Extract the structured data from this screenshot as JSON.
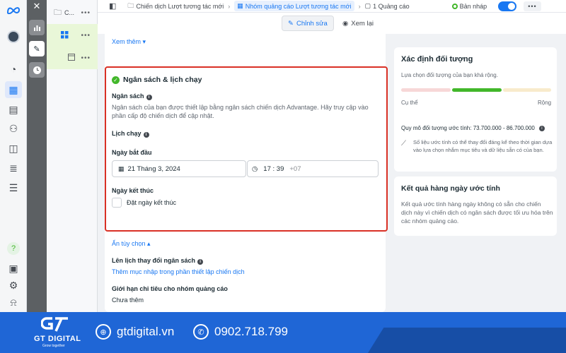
{
  "topbar": {
    "campaign": "Chiến dịch Lượt tương tác mới",
    "adset": "Nhóm quảng cáo Lượt tương tác mới",
    "ad": "1 Quảng cáo",
    "status": "Bản nháp"
  },
  "tree": {
    "campaign_label": "C..."
  },
  "mode": {
    "edit": "Chỉnh sửa",
    "review": "Xem lại"
  },
  "main": {
    "see_more": "Xem thêm",
    "section_title": "Ngân sách & lịch chạy",
    "budget_label": "Ngân sách",
    "budget_desc": "Ngân sách của bạn được thiết lập bằng ngân sách chiến dịch Advantage. Hãy truy cập vào phần cấp độ chiến dịch để cập nhật.",
    "schedule_label": "Lịch chạy",
    "start_label": "Ngày bắt đầu",
    "start_date": "21 Tháng 3, 2024",
    "start_time": "17 : 39",
    "timezone": "+07",
    "end_label": "Ngày kết thúc",
    "end_checkbox": "Đặt ngày kết thúc",
    "hide_options": "Ẩn tùy chọn",
    "budget_schedule_label": "Lên lịch thay đổi ngân sách",
    "budget_schedule_link": "Thêm mục nhập trong phần thiết lập chiến dịch",
    "spend_limit_label": "Giới hạn chi tiêu cho nhóm quảng cáo",
    "spend_limit_value": "Chưa thêm"
  },
  "audience": {
    "title": "Xác định đối tượng",
    "desc": "Lựa chọn đối tượng của bạn khá rộng.",
    "specific": "Cụ thể",
    "broad": "Rộng",
    "size": "Quy mô đối tượng ước tính: 73.700.000 - 86.700.000",
    "note": "Số liệu ước tính có thể thay đổi đáng kể theo thời gian dựa vào lựa chọn nhắm mục tiêu và dữ liệu sẵn có của bạn."
  },
  "daily": {
    "title": "Kết quả hàng ngày ước tính",
    "desc": "Kết quả ước tính hàng ngày không có sẵn cho chiến dịch này vì chiến dịch có ngân sách được tối ưu hóa trên các nhóm quảng cáo."
  },
  "banner": {
    "brand": "GT DIGITAL",
    "tagline": "Grow together",
    "website": "gtdigital.vn",
    "phone": "0902.718.799"
  },
  "colors": {
    "accent": "#1877f2",
    "highlight_border": "#d93025",
    "banner": "#1f66d6",
    "status_green": "#42b72a"
  }
}
